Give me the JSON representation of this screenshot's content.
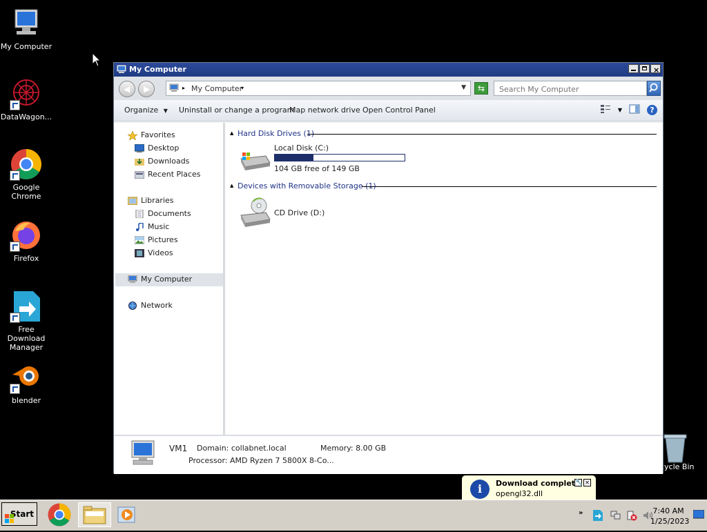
{
  "desktop": {
    "icons": [
      {
        "label": "My Computer"
      },
      {
        "label": "DataWagon..."
      },
      {
        "label": "Google Chrome"
      },
      {
        "label": "Firefox"
      },
      {
        "label": "Free Download Manager"
      },
      {
        "label": "blender"
      }
    ],
    "recycle_label": "cycle Bin"
  },
  "window": {
    "title": "My Computer",
    "address": "My Computer",
    "search_placeholder": "Search My Computer",
    "toolbar": {
      "organize": "Organize",
      "uninstall": "Uninstall or change a program",
      "map_drive": "Map network drive",
      "control_panel": "Open Control Panel"
    },
    "nav": {
      "favorites": "Favorites",
      "desktop": "Desktop",
      "downloads": "Downloads",
      "recent": "Recent Places",
      "libraries": "Libraries",
      "documents": "Documents",
      "music": "Music",
      "pictures": "Pictures",
      "videos": "Videos",
      "my_computer": "My Computer",
      "network": "Network"
    },
    "groups": {
      "hdd_header": "Hard Disk Drives (1)",
      "removable_header": "Devices with Removable Storage (1)"
    },
    "drives": {
      "c_name": "Local Disk (C:)",
      "c_free": "104 GB free of 149 GB",
      "c_used_fraction": 0.3,
      "d_name": "CD Drive (D:)"
    },
    "details": {
      "name": "VM1",
      "domain": "Domain: collabnet.local",
      "memory": "Memory: 8.00 GB",
      "processor": "Processor: AMD Ryzen 7 5800X 8-Co..."
    }
  },
  "notification": {
    "title": "Download complete",
    "text": "opengl32.dll"
  },
  "taskbar": {
    "start": "Start",
    "time": "7:40 AM",
    "date": "1/25/2023"
  },
  "colors": {
    "title_bar": "#1f3b84",
    "progress_fill": "#1d2f6a",
    "balloon_bg": "#ffffe1"
  }
}
